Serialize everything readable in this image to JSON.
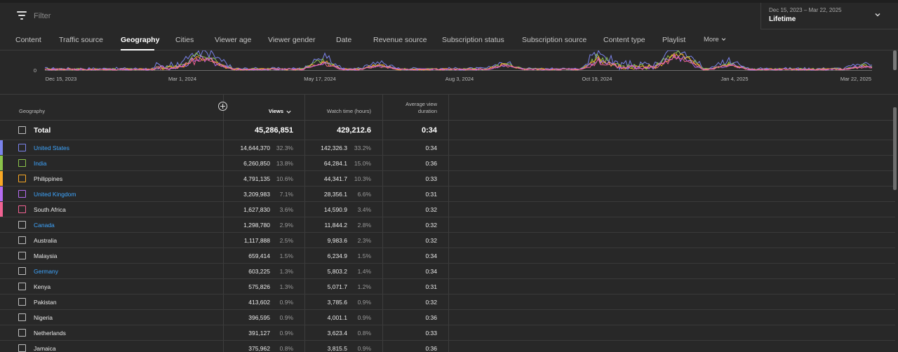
{
  "filter": {
    "placeholder": "Filter",
    "icon": "filter-icon"
  },
  "date": {
    "range": "Dec 15, 2023 – Mar 22, 2025",
    "label": "Lifetime",
    "icon": "chevron-down-icon"
  },
  "tabs": [
    {
      "label": "Content"
    },
    {
      "label": "Traffic source"
    },
    {
      "label": "Geography",
      "active": true
    },
    {
      "label": "Cities"
    },
    {
      "label": "Viewer age"
    },
    {
      "label": "Viewer gender"
    },
    {
      "label": "Date"
    },
    {
      "label": "Revenue source"
    },
    {
      "label": "Subscription status"
    },
    {
      "label": "Subscription source"
    },
    {
      "label": "Content type"
    },
    {
      "label": "Playlist"
    },
    {
      "label": "More",
      "icon": "chevron-down-icon"
    }
  ],
  "chart_data": {
    "type": "line",
    "x_ticks": [
      "Dec 15, 2023",
      "Mar 1, 2024",
      "May 17, 2024",
      "Aug 3, 2024",
      "Oct 19, 2024",
      "Jan 4, 2025",
      "Mar 22, 2025"
    ],
    "y_ticks": [
      "0"
    ],
    "series": [
      {
        "name": "United States",
        "color": "#7b83eb"
      },
      {
        "name": "India",
        "color": "#8bc34a"
      },
      {
        "name": "Philippines",
        "color": "#f9a825"
      },
      {
        "name": "United Kingdom",
        "color": "#b56cf0"
      },
      {
        "name": "South Africa",
        "color": "#f06292"
      }
    ]
  },
  "table": {
    "headers": {
      "geography": "Geography",
      "views": "Views",
      "watch_time": "Watch time (hours)",
      "avg_duration_1": "Average view",
      "avg_duration_2": "duration"
    },
    "total": {
      "label": "Total",
      "views": "45,286,851",
      "watch": "429,212.6",
      "avg": "0:34"
    },
    "rows": [
      {
        "name": "United States",
        "link": true,
        "views": "14,644,370",
        "vpct": "32.3%",
        "watch": "142,326.3",
        "wpct": "33.2%",
        "avg": "0:34",
        "color": "#7b83eb"
      },
      {
        "name": "India",
        "link": true,
        "views": "6,260,850",
        "vpct": "13.8%",
        "watch": "64,284.1",
        "wpct": "15.0%",
        "avg": "0:36",
        "color": "#8bc34a"
      },
      {
        "name": "Philippines",
        "link": false,
        "views": "4,791,135",
        "vpct": "10.6%",
        "watch": "44,341.7",
        "wpct": "10.3%",
        "avg": "0:33",
        "color": "#f9a825"
      },
      {
        "name": "United Kingdom",
        "link": true,
        "views": "3,209,983",
        "vpct": "7.1%",
        "watch": "28,356.1",
        "wpct": "6.6%",
        "avg": "0:31",
        "color": "#b56cf0"
      },
      {
        "name": "South Africa",
        "link": false,
        "views": "1,627,830",
        "vpct": "3.6%",
        "watch": "14,590.9",
        "wpct": "3.4%",
        "avg": "0:32",
        "color": "#f06292"
      },
      {
        "name": "Canada",
        "link": true,
        "views": "1,298,780",
        "vpct": "2.9%",
        "watch": "11,844.2",
        "wpct": "2.8%",
        "avg": "0:32",
        "color": ""
      },
      {
        "name": "Australia",
        "link": false,
        "views": "1,117,888",
        "vpct": "2.5%",
        "watch": "9,983.6",
        "wpct": "2.3%",
        "avg": "0:32",
        "color": ""
      },
      {
        "name": "Malaysia",
        "link": false,
        "views": "659,414",
        "vpct": "1.5%",
        "watch": "6,234.9",
        "wpct": "1.5%",
        "avg": "0:34",
        "color": ""
      },
      {
        "name": "Germany",
        "link": true,
        "views": "603,225",
        "vpct": "1.3%",
        "watch": "5,803.2",
        "wpct": "1.4%",
        "avg": "0:34",
        "color": ""
      },
      {
        "name": "Kenya",
        "link": false,
        "views": "575,826",
        "vpct": "1.3%",
        "watch": "5,071.7",
        "wpct": "1.2%",
        "avg": "0:31",
        "color": ""
      },
      {
        "name": "Pakistan",
        "link": false,
        "views": "413,602",
        "vpct": "0.9%",
        "watch": "3,785.6",
        "wpct": "0.9%",
        "avg": "0:32",
        "color": ""
      },
      {
        "name": "Nigeria",
        "link": false,
        "views": "396,595",
        "vpct": "0.9%",
        "watch": "4,001.1",
        "wpct": "0.9%",
        "avg": "0:36",
        "color": ""
      },
      {
        "name": "Netherlands",
        "link": false,
        "views": "391,127",
        "vpct": "0.9%",
        "watch": "3,623.4",
        "wpct": "0.8%",
        "avg": "0:33",
        "color": ""
      },
      {
        "name": "Jamaica",
        "link": false,
        "views": "375,962",
        "vpct": "0.8%",
        "watch": "3,815.5",
        "wpct": "0.9%",
        "avg": "0:36",
        "color": ""
      }
    ]
  }
}
